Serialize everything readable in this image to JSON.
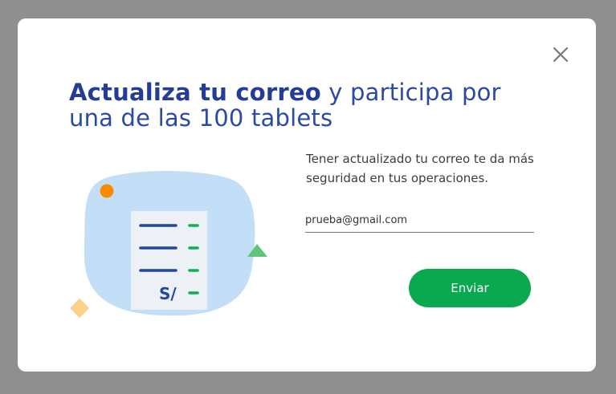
{
  "modal": {
    "headline_bold": "Actualiza tu correo",
    "headline_rest": " y participa por una de las 100 tablets",
    "description": "Tener actualizado tu correo te da más seguridad en tus operaciones.",
    "email": {
      "value": "prueba@gmail.com"
    },
    "submit_label": "Enviar",
    "close_icon": "close-icon"
  },
  "illustration": {
    "currency_label": "S/",
    "icon": "document-icon"
  },
  "colors": {
    "primary_blue": "#2a4aa6",
    "accent_green": "#0aa84f",
    "blob_blue": "#c2dff7",
    "orange_dot": "#fb8c00",
    "yellow_diamond": "#fdd18a",
    "green_triangle": "#5ec57b"
  }
}
